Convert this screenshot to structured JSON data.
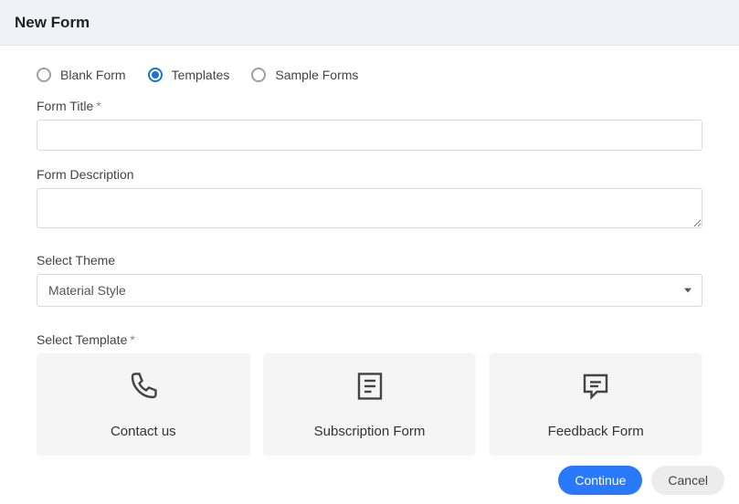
{
  "header": {
    "title": "New Form"
  },
  "radios": {
    "blank": "Blank Form",
    "templates": "Templates",
    "sample": "Sample Forms",
    "selected": "templates"
  },
  "fields": {
    "title_label": "Form Title",
    "title_required": "*",
    "title_value": "",
    "desc_label": "Form Description",
    "desc_value": "",
    "theme_label": "Select Theme",
    "theme_value": "Material Style",
    "template_label": "Select Template",
    "template_required": "*"
  },
  "templates": [
    {
      "icon": "phone-icon",
      "label": "Contact us"
    },
    {
      "icon": "document-icon",
      "label": "Subscription Form"
    },
    {
      "icon": "chat-icon",
      "label": "Feedback Form"
    }
  ],
  "buttons": {
    "continue": "Continue",
    "cancel": "Cancel"
  }
}
